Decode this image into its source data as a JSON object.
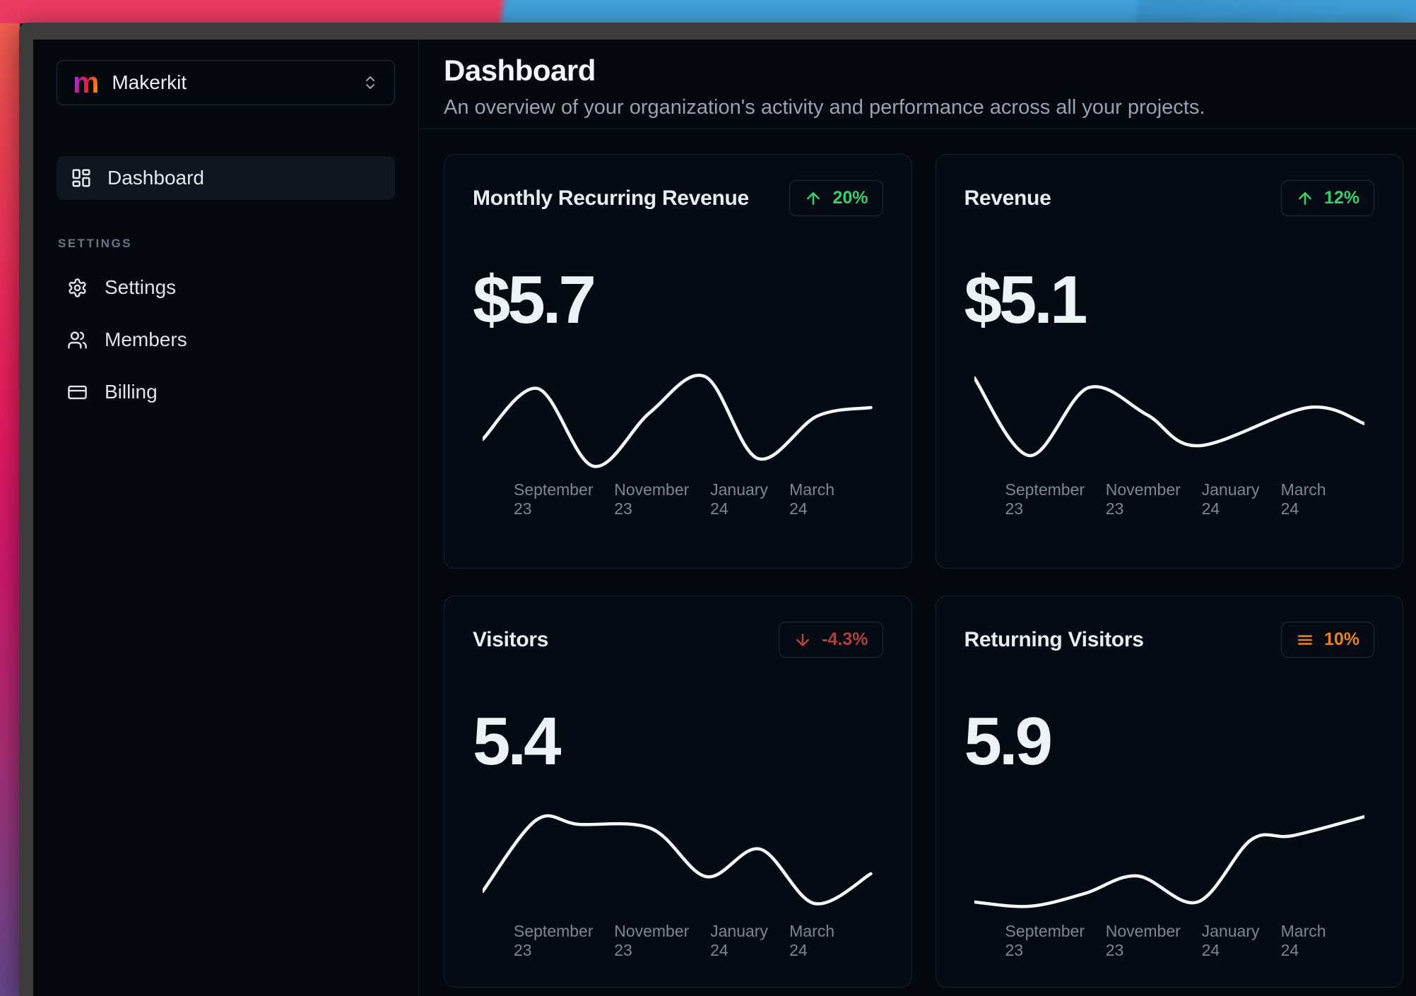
{
  "sidebar": {
    "workspace": {
      "name": "Makerkit",
      "logo_letter": "m"
    },
    "nav": [
      {
        "label": "Dashboard",
        "icon": "dashboard-icon",
        "active": true
      }
    ],
    "section_label": "SETTINGS",
    "settings_nav": [
      {
        "label": "Settings",
        "icon": "gear-icon"
      },
      {
        "label": "Members",
        "icon": "users-icon"
      },
      {
        "label": "Billing",
        "icon": "credit-card-icon"
      }
    ]
  },
  "header": {
    "title": "Dashboard",
    "subtitle": "An overview of your organization's activity and performance across all your projects."
  },
  "colors": {
    "positive": "#37cf6e",
    "negative": "#b04141",
    "neutral": "#e8821f",
    "line": "#f5f7fa"
  },
  "cards": [
    {
      "title": "Monthly Recurring Revenue",
      "value": "$5.7",
      "badge": {
        "icon": "arrow-up",
        "label": "20%",
        "color": "#37cf6e"
      }
    },
    {
      "title": "Revenue",
      "value": "$5.1",
      "badge": {
        "icon": "arrow-up",
        "label": "12%",
        "color": "#37cf6e"
      }
    },
    {
      "title": "Visitors",
      "value": "5.4",
      "badge": {
        "icon": "arrow-down",
        "label": "-4.3%",
        "color": "#b04141"
      }
    },
    {
      "title": "Returning Visitors",
      "value": "5.9",
      "badge": {
        "icon": "menu",
        "label": "10%",
        "color": "#e8821f"
      }
    }
  ],
  "chart_data": [
    {
      "type": "line",
      "metric": "Monthly Recurring Revenue",
      "x_labels": [
        "September 23",
        "November 23",
        "January 24",
        "March 24"
      ],
      "x_range": [
        "August 23",
        "April 24"
      ],
      "grid": false,
      "legend": false,
      "points": [
        [
          0,
          100
        ],
        [
          75,
          28
        ],
        [
          151,
          138
        ],
        [
          228,
          62
        ],
        [
          303,
          11
        ],
        [
          375,
          127
        ],
        [
          456,
          67
        ],
        [
          529,
          55
        ]
      ]
    },
    {
      "type": "line",
      "metric": "Revenue",
      "x_labels": [
        "September 23",
        "November 23",
        "January 24",
        "March 24"
      ],
      "x_range": [
        "August 23",
        "April 24"
      ],
      "grid": false,
      "legend": false,
      "points": [
        [
          0,
          13
        ],
        [
          75,
          123
        ],
        [
          155,
          27
        ],
        [
          235,
          65
        ],
        [
          306,
          109
        ],
        [
          455,
          55
        ],
        [
          532,
          78
        ]
      ]
    },
    {
      "type": "line",
      "metric": "Visitors",
      "x_labels": [
        "September 23",
        "November 23",
        "January 24",
        "March 24"
      ],
      "x_range": [
        "August 23",
        "April 24"
      ],
      "grid": false,
      "legend": false,
      "points": [
        [
          0,
          115
        ],
        [
          73,
          14
        ],
        [
          131,
          20
        ],
        [
          230,
          26
        ],
        [
          305,
          94
        ],
        [
          378,
          55
        ],
        [
          452,
          132
        ],
        [
          529,
          90
        ]
      ]
    },
    {
      "type": "line",
      "metric": "Returning Visitors",
      "x_labels": [
        "September 23",
        "November 23",
        "January 24",
        "March 24"
      ],
      "x_range": [
        "August 23",
        "April 24"
      ],
      "grid": false,
      "legend": false,
      "points": [
        [
          0,
          130
        ],
        [
          75,
          136
        ],
        [
          150,
          118
        ],
        [
          222,
          93
        ],
        [
          304,
          130
        ],
        [
          377,
          42
        ],
        [
          434,
          36
        ],
        [
          532,
          9
        ]
      ]
    }
  ]
}
